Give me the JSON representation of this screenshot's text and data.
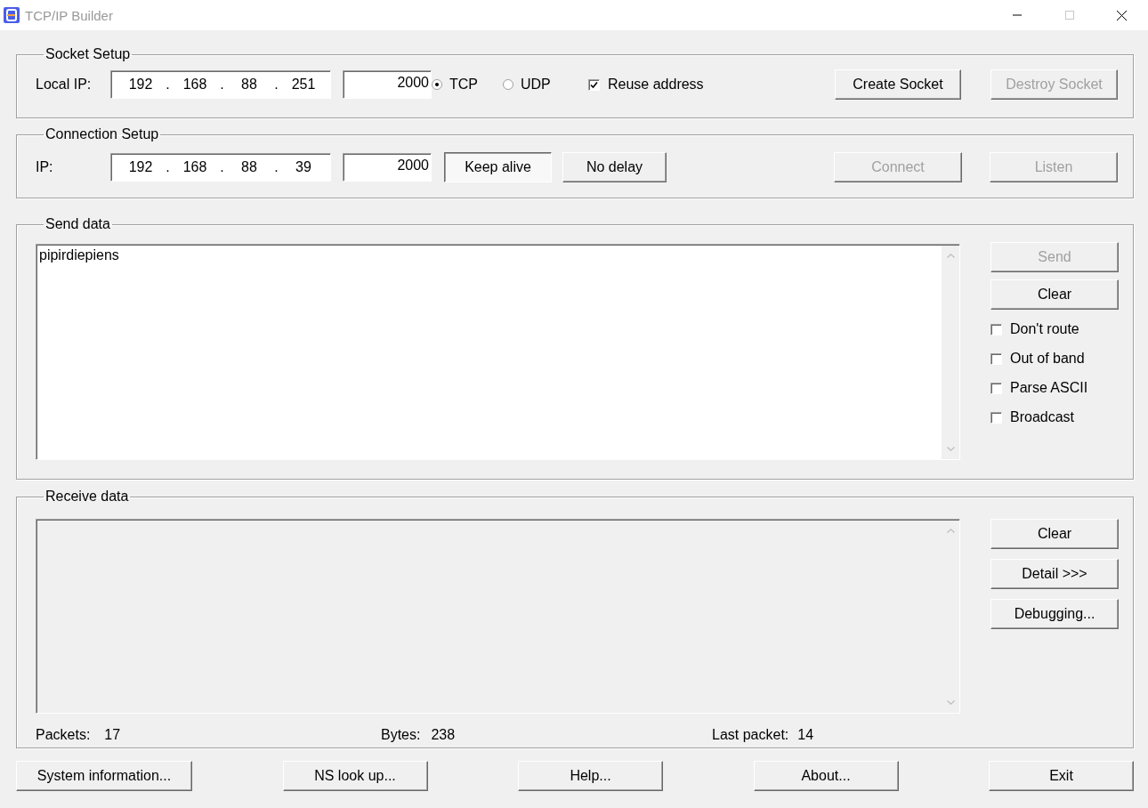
{
  "window": {
    "title": "TCP/IP Builder"
  },
  "socket_setup": {
    "title": "Socket Setup",
    "ip_label": "Local IP:",
    "ip_parts": [
      "192",
      ".",
      "168",
      ".",
      "88",
      ".",
      "251"
    ],
    "port": "2000",
    "protocols": [
      {
        "label": "TCP",
        "selected": true
      },
      {
        "label": "UDP",
        "selected": false
      }
    ],
    "reuse_address": {
      "label": "Reuse address",
      "checked": true
    },
    "buttons": [
      {
        "label": "Create Socket",
        "disabled": false
      },
      {
        "label": "Destroy Socket",
        "disabled": true
      }
    ]
  },
  "connection_setup": {
    "title": "Connection Setup",
    "ip_label": "IP:",
    "ip_parts": [
      "192",
      ".",
      "168",
      ".",
      "88",
      ".",
      "39"
    ],
    "port": "2000",
    "toggles": [
      {
        "label": "Keep alive",
        "pressed": true
      },
      {
        "label": "No delay",
        "pressed": false
      }
    ],
    "buttons": [
      {
        "label": "Connect",
        "disabled": true
      },
      {
        "label": "Listen",
        "disabled": true
      }
    ]
  },
  "send_data": {
    "title": "Send data",
    "text": "pipirdiepiens",
    "buttons": [
      {
        "label": "Send",
        "disabled": true
      },
      {
        "label": "Clear",
        "disabled": false
      }
    ],
    "options": [
      {
        "label": "Don't route",
        "checked": false
      },
      {
        "label": "Out of band",
        "checked": false
      },
      {
        "label": "Parse ASCII",
        "checked": false
      },
      {
        "label": "Broadcast",
        "checked": false
      }
    ]
  },
  "receive_data": {
    "title": "Receive data",
    "buttons": [
      {
        "label": "Clear",
        "disabled": false
      },
      {
        "label": "Detail >>>",
        "disabled": false
      },
      {
        "label": "Debugging...",
        "disabled": false
      }
    ],
    "stats": [
      {
        "label": "Packets:",
        "value": "17"
      },
      {
        "label": "Bytes:",
        "value": "238"
      },
      {
        "label": "Last packet:",
        "value": "14"
      }
    ]
  },
  "bottom_buttons": [
    {
      "label": "System information...",
      "disabled": false
    },
    {
      "label": "NS look up...",
      "disabled": false
    },
    {
      "label": "Help...",
      "disabled": false
    },
    {
      "label": "About...",
      "disabled": false
    },
    {
      "label": "Exit",
      "disabled": false
    }
  ]
}
